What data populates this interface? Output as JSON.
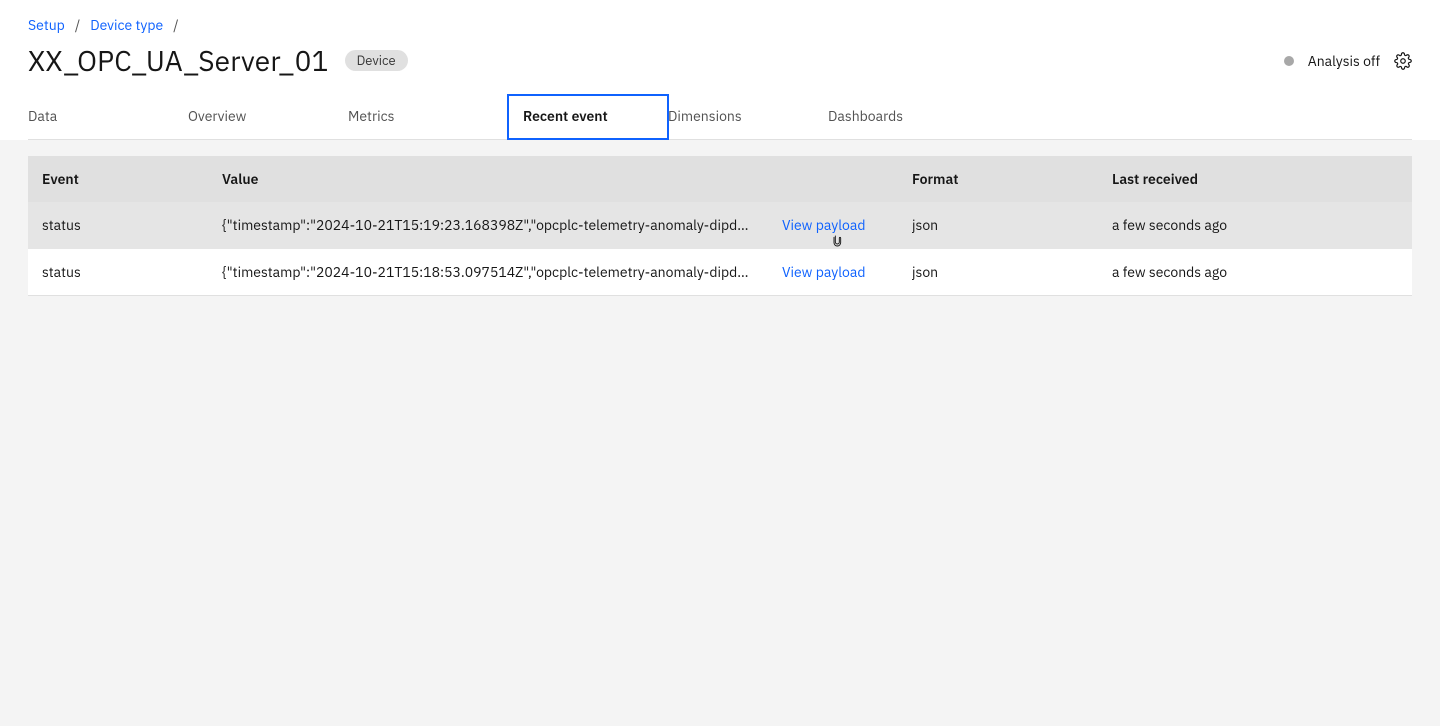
{
  "breadcrumb": {
    "items": [
      "Setup",
      "Device type"
    ]
  },
  "header": {
    "title": "XX_OPC_UA_Server_01",
    "badge": "Device",
    "analysis_status": "Analysis off"
  },
  "tabs": {
    "items": [
      {
        "label": "Data"
      },
      {
        "label": "Overview"
      },
      {
        "label": "Metrics"
      },
      {
        "label": "Recent event",
        "active": true
      },
      {
        "label": "Dimensions"
      },
      {
        "label": "Dashboards"
      }
    ]
  },
  "table": {
    "columns": {
      "event": "Event",
      "value": "Value",
      "format": "Format",
      "last_received": "Last received"
    },
    "link_label": "View payload",
    "rows": [
      {
        "event": "status",
        "value": "{\"timestamp\":\"2024-10-21T15:19:23.168398Z\",\"opcplc-telemetry-anomaly-dipd…",
        "format": "json",
        "last_received": "a few seconds ago",
        "hovered": true
      },
      {
        "event": "status",
        "value": "{\"timestamp\":\"2024-10-21T15:18:53.097514Z\",\"opcplc-telemetry-anomaly-dipd…",
        "format": "json",
        "last_received": "a few seconds ago"
      }
    ]
  }
}
